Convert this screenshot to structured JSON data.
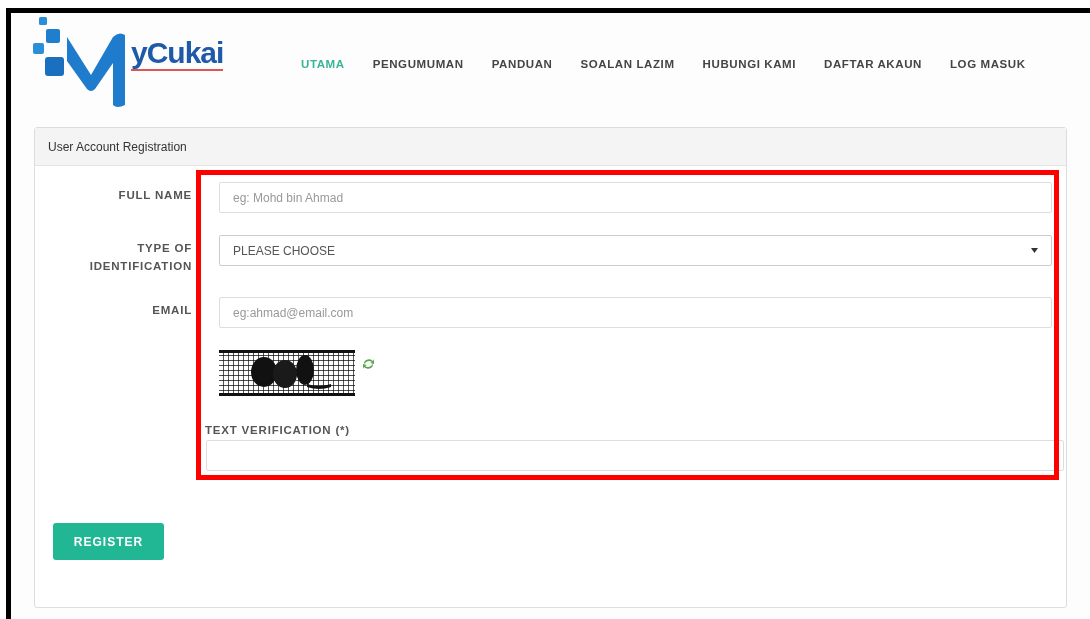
{
  "brand": {
    "logo_text": "yCukai"
  },
  "nav": [
    {
      "label": "UTAMA",
      "selected": true
    },
    {
      "label": "PENGUMUMAN",
      "selected": false
    },
    {
      "label": "PANDUAN",
      "selected": false
    },
    {
      "label": "SOALAN LAZIM",
      "selected": false
    },
    {
      "label": "HUBUNGI KAMI",
      "selected": false
    },
    {
      "label": "DAFTAR AKAUN",
      "selected": false
    },
    {
      "label": "LOG MASUK",
      "selected": false
    }
  ],
  "panel": {
    "title": "User Account Registration",
    "fields": [
      {
        "kind": "text",
        "label": "FULL NAME",
        "placeholder": "eg: Mohd bin Ahmad"
      },
      {
        "kind": "select",
        "label": "TYPE OF IDENTIFICATION",
        "value": "PLEASE CHOOSE"
      },
      {
        "kind": "text",
        "label": "EMAIL",
        "placeholder": "eg:ahmad@email.com"
      }
    ],
    "verification": {
      "label": "TEXT VERIFICATION (*)"
    },
    "register_button": "REGISTER"
  }
}
